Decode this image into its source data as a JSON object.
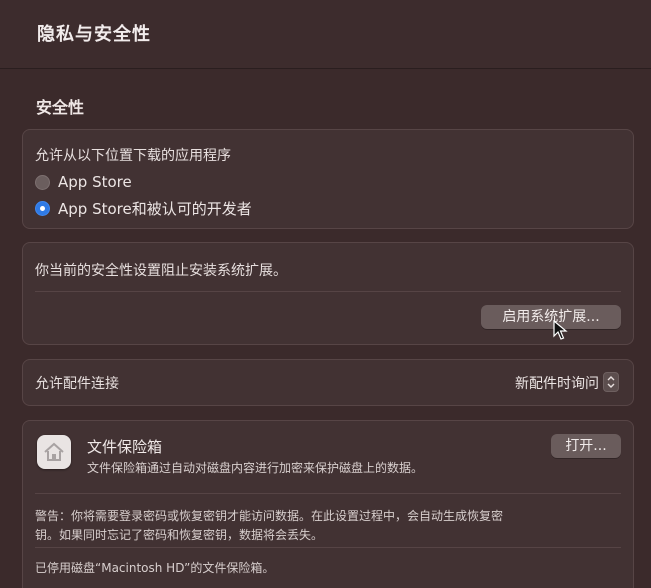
{
  "window": {
    "title": "隐私与安全性"
  },
  "section": {
    "title": "安全性"
  },
  "downloads": {
    "heading": "允许从以下位置下载的应用程序",
    "options": [
      {
        "label": "App Store",
        "selected": false
      },
      {
        "label": "App Store和被认可的开发者",
        "selected": true
      }
    ]
  },
  "extensions": {
    "message": "你当前的安全性设置阻止安装系统扩展。",
    "button_label": "启用系统扩展..."
  },
  "accessories": {
    "label": "允许配件连接",
    "selected_value": "新配件时询问"
  },
  "filevault": {
    "title": "文件保险箱",
    "description": "文件保险箱通过自动对磁盘内容进行加密来保护磁盘上的数据。",
    "button_label": "打开...",
    "warning_line1": "警告：你将需要登录密码或恢复密钥才能访问数据。在此设置过程中，会自动生成恢复密",
    "warning_line2": "钥。如果同时忘记了密码和恢复密钥，数据将会丢失。",
    "status": "已停用磁盘“Macintosh HD”的文件保险箱。"
  },
  "colors": {
    "background": "#3b2a2b",
    "card": "#423233",
    "accent": "#2f7ae5",
    "button": "#6a5c5c"
  },
  "icons": [
    "radio-unchecked-icon",
    "radio-checked-icon",
    "updown-chevron-icon",
    "house-icon",
    "mouse-pointer-icon"
  ]
}
